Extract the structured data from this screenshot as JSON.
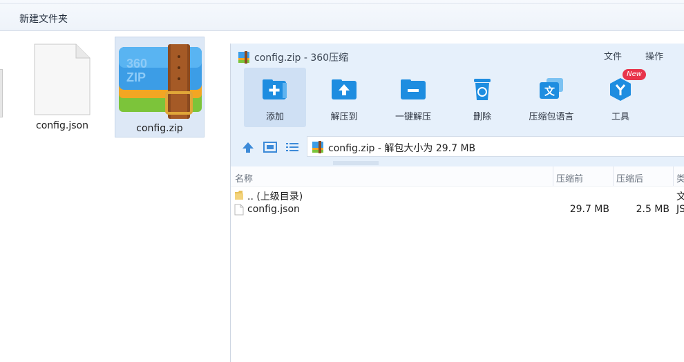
{
  "explorer": {
    "new_folder_label": "新建文件夹",
    "files": [
      {
        "name": "config.json",
        "icon": "document-icon"
      },
      {
        "name": "config.zip",
        "icon": "360zip-archive-icon",
        "selected": true
      }
    ]
  },
  "zip_window": {
    "title": "config.zip - 360压缩",
    "menu": {
      "file": "文件",
      "ops": "操作"
    },
    "toolbar": [
      {
        "label": "添加",
        "icon": "add-icon",
        "active": true
      },
      {
        "label": "解压到",
        "icon": "extract-to-icon"
      },
      {
        "label": "一键解压",
        "icon": "one-click-extract-icon"
      },
      {
        "label": "删除",
        "icon": "recycle-bin-icon"
      },
      {
        "label": "压缩包语言",
        "icon": "archive-language-icon"
      },
      {
        "label": "工具",
        "icon": "tools-icon",
        "badge": "New"
      }
    ],
    "path_text": "config.zip - 解包大小为 29.7 MB",
    "columns": {
      "name": "名称",
      "before": "压缩前",
      "after": "压缩后",
      "type": "类"
    },
    "rows": [
      {
        "name": ".. (上级目录)",
        "before": "",
        "after": "",
        "type": "文",
        "icon": "folder-icon"
      },
      {
        "name": "config.json",
        "before": "29.7 MB",
        "after": "2.5 MB",
        "type": "JS",
        "icon": "file-icon"
      }
    ],
    "colors": {
      "header_bg": "#e6f0fb",
      "icon_blue": "#1e8de0",
      "badge_red": "#e8344b"
    }
  }
}
